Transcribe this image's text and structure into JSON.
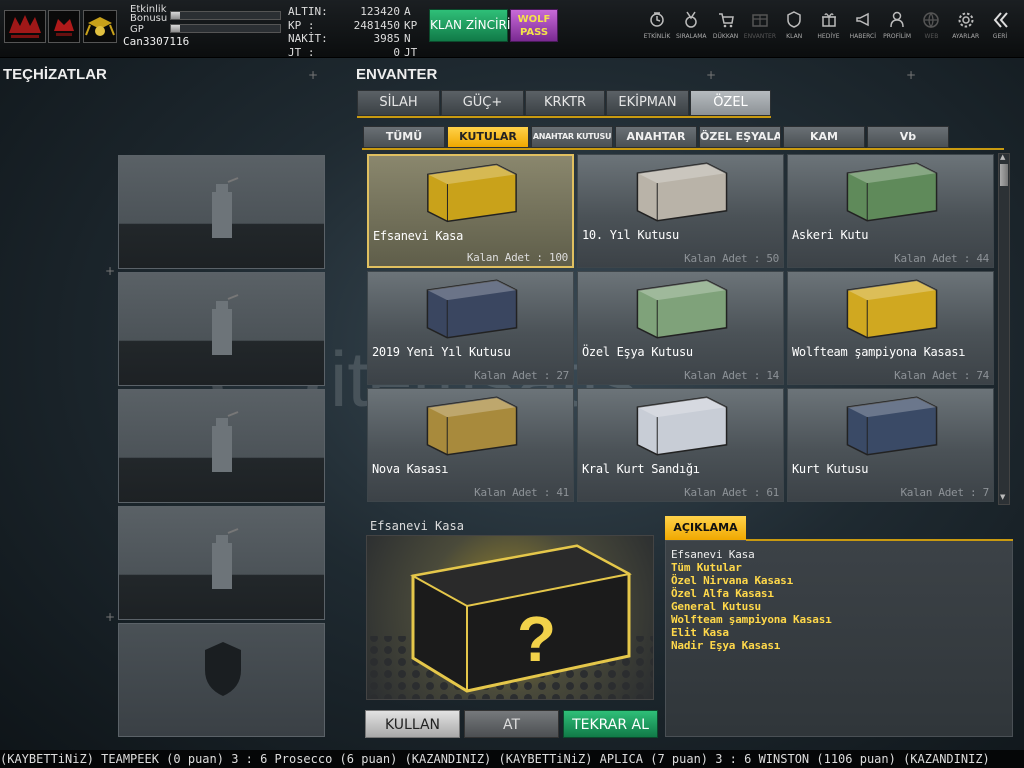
{
  "topbar": {
    "event_bonus_label_1": "Etkinlik",
    "event_bonus_label_2": "Bonusu",
    "event_bonus_fill": 0.08,
    "gp_label": "GP",
    "gp_fill": 0.08,
    "username": "Can3307116",
    "currencies": [
      {
        "label": "ALTIN:",
        "value": "123420",
        "unit": "A"
      },
      {
        "label": "KP :",
        "value": "2481450",
        "unit": "KP"
      },
      {
        "label": "NAKİT:",
        "value": "3985",
        "unit": "N"
      },
      {
        "label": "JT :",
        "value": "0",
        "unit": "JT"
      }
    ],
    "clan_chain_label": "KLAN ZİNCİRİ",
    "wolf_pass_label_1": "WOLF",
    "wolf_pass_label_2": "PASS",
    "nav": [
      {
        "label": "ETKİNLİK",
        "icon": "clock-icon"
      },
      {
        "label": "SIRALAMA",
        "icon": "medal-icon"
      },
      {
        "label": "DÜKKAN",
        "icon": "cart-icon"
      },
      {
        "label": "ENVANTER",
        "icon": "inventory-icon"
      },
      {
        "label": "KLAN",
        "icon": "shield-icon"
      },
      {
        "label": "HEDİYE",
        "icon": "gift-icon"
      },
      {
        "label": "HABERCİ",
        "icon": "megaphone-icon"
      },
      {
        "label": "PROFİLİM",
        "icon": "profile-icon"
      },
      {
        "label": "WEB",
        "icon": "globe-icon"
      },
      {
        "label": "AYARLAR",
        "icon": "gear-icon"
      },
      {
        "label": "GERİ",
        "icon": "back-icon"
      }
    ]
  },
  "equipment": {
    "title": "TEÇHİZATLAR",
    "slots": [
      {
        "icon": "grenade-icon"
      },
      {
        "icon": "grenade-icon"
      },
      {
        "icon": "grenade-icon"
      },
      {
        "icon": "grenade-icon"
      },
      {
        "icon": "armor-shield-icon"
      }
    ]
  },
  "inventory": {
    "title": "ENVANTER",
    "tabs": [
      "SİLAH",
      "GÜÇ+",
      "KRKTR",
      "EKİPMAN",
      "ÖZEL"
    ],
    "active_tab": 4,
    "subtabs": [
      "TÜMÜ",
      "KUTULAR",
      "ANAHTAR KUTUSU",
      "ANAHTAR",
      "ÖZEL EŞYALAR",
      "KAM",
      "Vb"
    ],
    "active_subtab": 1,
    "items": [
      {
        "name": "Efsanevi Kasa",
        "qty": "Kalan Adet : 100",
        "selected": true,
        "color": "#c9a21a"
      },
      {
        "name": "10. Yıl Kutusu",
        "qty": "Kalan Adet : 50",
        "color": "#b9b3a8"
      },
      {
        "name": "Askeri Kutu",
        "qty": "Kalan Adet : 44",
        "color": "#5f8a5a"
      },
      {
        "name": "2019 Yeni Yıl Kutusu",
        "qty": "Kalan Adet : 27",
        "color": "#3a4660"
      },
      {
        "name": "Özel Eşya Kutusu",
        "qty": "Kalan Adet : 14",
        "color": "#7fa27a"
      },
      {
        "name": "Wolfteam şampiyona Kasası",
        "qty": "Kalan Adet : 74",
        "color": "#d0a820"
      },
      {
        "name": "Nova Kasası",
        "qty": "Kalan Adet : 41",
        "color": "#a88a3c"
      },
      {
        "name": "Kral Kurt Sandığı",
        "qty": "Kalan Adet : 61",
        "color": "#c8cdd6"
      },
      {
        "name": "Kurt Kutusu",
        "qty": "Kalan Adet : 7",
        "color": "#3a4a66"
      }
    ]
  },
  "preview": {
    "title": "Efsanevi Kasa"
  },
  "description": {
    "tab_label": "AÇIKLAMA",
    "lines": [
      {
        "text": "Efsanevi Kasa",
        "style": "plain"
      },
      {
        "text": "Tüm Kutular",
        "style": "gold"
      },
      {
        "text": "Özel Nirvana Kasası",
        "style": "gold"
      },
      {
        "text": "Özel Alfa Kasası",
        "style": "gold"
      },
      {
        "text": "General Kutusu",
        "style": "gold"
      },
      {
        "text": "Wolfteam şampiyona Kasası",
        "style": "gold"
      },
      {
        "text": "Elit Kasa",
        "style": "gold"
      },
      {
        "text": "Nadir Eşya Kasası",
        "style": "gold"
      }
    ]
  },
  "actions": {
    "use_label": "KULLAN",
    "drop_label": "AT",
    "repeat_label": "TEKRAR AL"
  },
  "ticker": {
    "text": "(KAYBETTiNiZ) TEAMPEEK (0 puan) 3 : 6 Prosecco (6 puan) (KAZANDINIZ)    (KAYBETTiNiZ) APLICA (7 puan) 3 : 6 WINSTON (1106 puan) (KAZANDINIZ)"
  },
  "watermark": {
    "text": "itemsatis"
  }
}
